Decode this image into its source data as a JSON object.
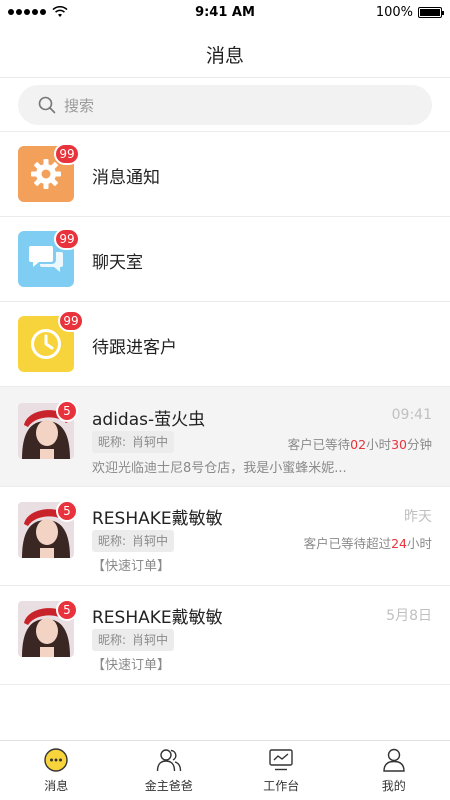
{
  "status_bar": {
    "time": "9:41 AM",
    "battery": "100%"
  },
  "header": {
    "title": "消息"
  },
  "search": {
    "placeholder": "搜索"
  },
  "entries": [
    {
      "label": "消息通知",
      "badge": "99",
      "icon": "gear-icon",
      "color": "#f3a05a"
    },
    {
      "label": "聊天室",
      "badge": "99",
      "icon": "chat-bubbles-icon",
      "color": "#7fcdf2"
    },
    {
      "label": "待跟进客户",
      "badge": "99",
      "icon": "clock-icon",
      "color": "#f8d43c"
    }
  ],
  "chats": [
    {
      "name": "adidas-萤火虫",
      "time": "09:41",
      "badge": "5",
      "nickname_label": "昵称:",
      "nickname": "肖轲中",
      "wait_prefix": "客户已等待",
      "wait_hours": "02",
      "wait_hours_unit": "小时",
      "wait_minutes": "30",
      "wait_minutes_unit": "分钟",
      "preview": "欢迎光临迪士尼8号仓店，我是小蜜蜂米妮..."
    },
    {
      "name": "RESHAKE戴敏敏",
      "time": "昨天",
      "badge": "5",
      "nickname_label": "昵称:",
      "nickname": "肖轲中",
      "wait_prefix": "客户已等待超过",
      "wait_hours": "24",
      "wait_hours_unit": "小时",
      "preview": "【快速订单】"
    },
    {
      "name": "RESHAKE戴敏敏",
      "time": "5月8日",
      "badge": "5",
      "nickname_label": "昵称:",
      "nickname": "肖轲中",
      "preview": "【快速订单】"
    }
  ],
  "tabs": [
    {
      "label": "消息",
      "icon": "message-bubble-icon",
      "active": true
    },
    {
      "label": "金主爸爸",
      "icon": "contacts-icon",
      "active": false
    },
    {
      "label": "工作台",
      "icon": "workbench-icon",
      "active": false
    },
    {
      "label": "我的",
      "icon": "profile-icon",
      "active": false
    }
  ],
  "colors": {
    "accent": "#f8d43c",
    "badge": "#e8323c",
    "wait_highlight": "#e8323c"
  }
}
